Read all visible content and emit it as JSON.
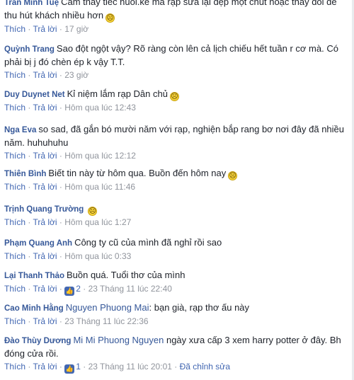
{
  "actions": {
    "reply": "Thích",
    "answer": "Trả lời",
    "dot": " · ",
    "edited": "Đã chỉnh sửa"
  },
  "comments": [
    {
      "author": "Trần Minh Tuệ",
      "text": "Cảm thấy tiếc nuối.kẻ mà rạp sửa lại đẹp một chút hoặc thay đổi để thu hút khách nhiều hơn",
      "time": "17 giờ"
    },
    {
      "author": "Quỳnh Trang",
      "text": "Sao đột ngột vậy? Rõ ràng còn lên cả lịch chiếu hết tuần r cơ mà. Có phải bị j đó chèn ép k vậy T.T.",
      "time": "23 giờ"
    },
    {
      "author": "Duy Duynet Net",
      "text": "Kỉ niệm lắm rạp Dân chủ",
      "time": "Hôm qua lúc 12:43"
    },
    {
      "author": "Nga Eva",
      "text": "so sad, đã gắn bó mười năm với rạp, nghiện bắp rang bơ nơi đây đã nhiều năm. huhuhuhu",
      "time": "Hôm qua lúc 12:12"
    },
    {
      "author": "Thiên Bình",
      "text": "Biết tin này từ hôm qua. Buồn đến hôm nay",
      "time": "Hôm qua lúc 11:46"
    },
    {
      "author": "Trịnh Quang Trường",
      "text": "",
      "time": "Hôm qua lúc 1:27"
    },
    {
      "author": "Phạm Quang Anh",
      "text": "Công ty cũ của mình đã nghỉ rồi sao",
      "time": "Hôm qua lúc 0:33"
    },
    {
      "author": "Lại Thanh Thảo",
      "text": "Buồn quá. Tuổi thơ của mình",
      "likes": "2",
      "time": "23 Tháng 11 lúc 22:40"
    },
    {
      "author": "Cao Minh Hằng",
      "mention": "Nguyen Phuong Mai",
      "text": ": bạn già, rạp thơ ấu này",
      "time": "23 Tháng 11 lúc 22:36"
    },
    {
      "author": "Đào Thùy Dương",
      "mention": "Mi Mi Phuong Nguyen",
      "text": " ngày xưa cấp 3 xem harry potter ở đây. Bh đóng cửa rồi.",
      "likes": "1",
      "time": "23 Tháng 11 lúc 20:01"
    }
  ]
}
